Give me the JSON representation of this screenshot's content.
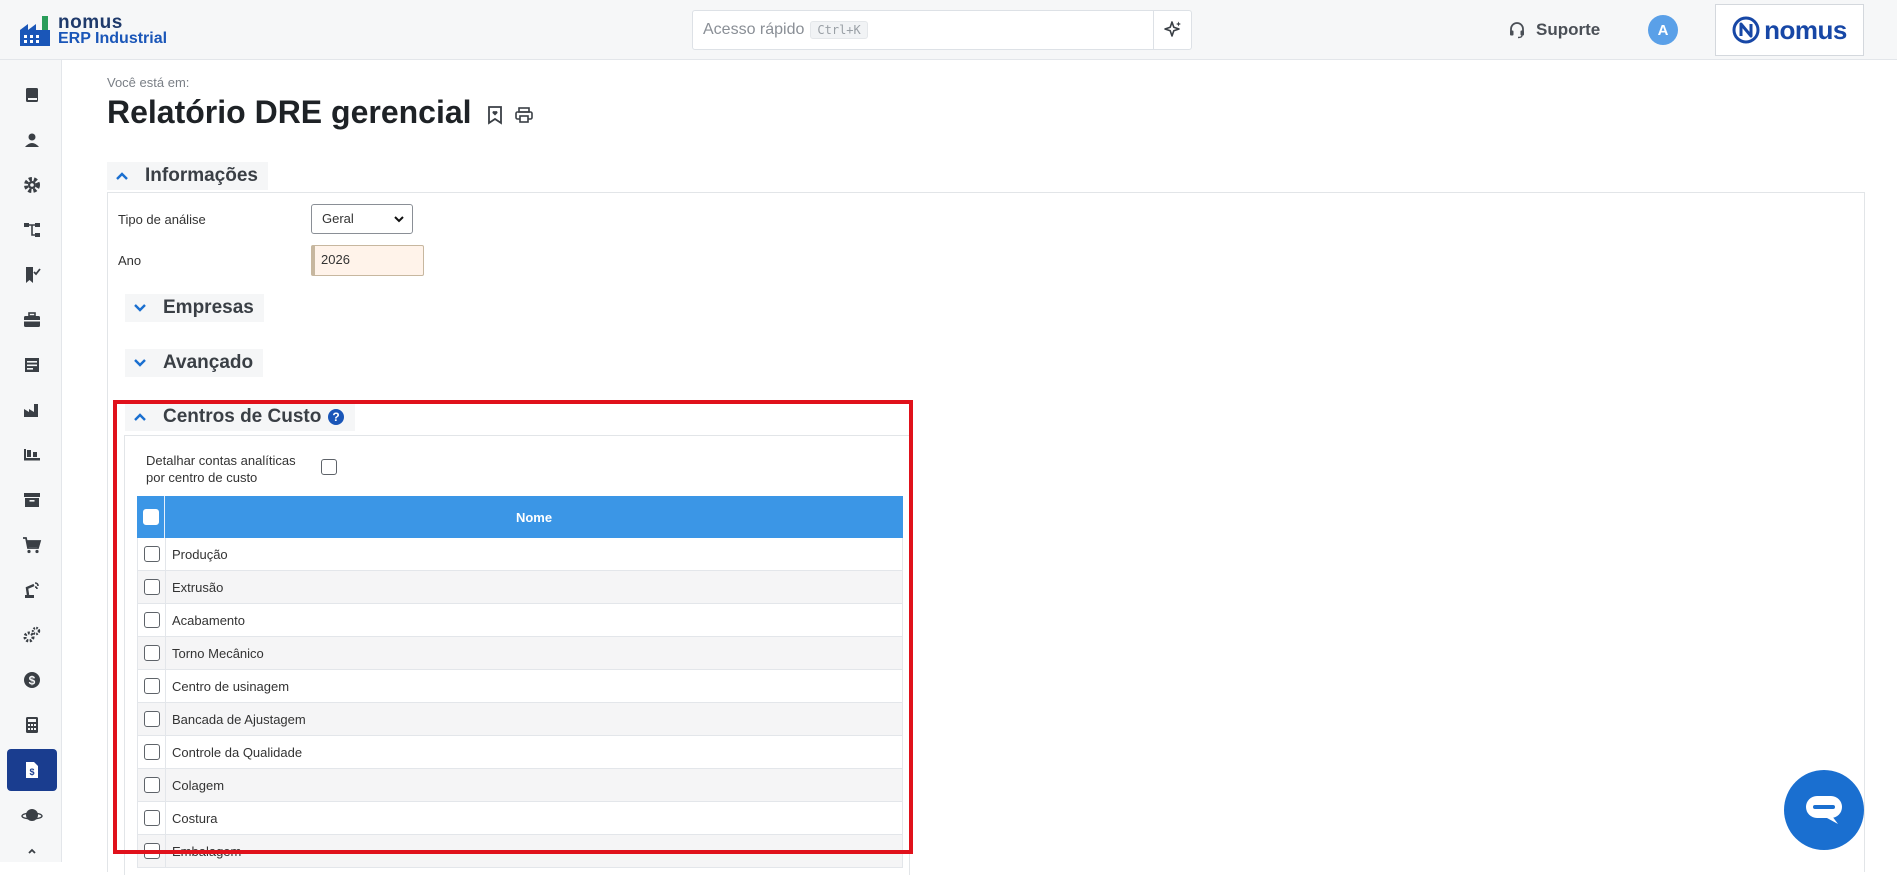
{
  "topbar": {
    "logo_line1": "nomus",
    "logo_line2": "ERP Industrial",
    "quick_access_placeholder": "Acesso rápido",
    "quick_access_shortcut": "Ctrl+K",
    "support_label": "Suporte",
    "avatar_initial": "A",
    "brand_text": "nomus"
  },
  "sidebar": {
    "items": [
      {
        "icon": "book-icon"
      },
      {
        "icon": "user-icon"
      },
      {
        "icon": "gear-icon"
      },
      {
        "icon": "hierarchy-icon"
      },
      {
        "icon": "bookmark-check-icon"
      },
      {
        "icon": "briefcase-icon"
      },
      {
        "icon": "document-list-icon"
      },
      {
        "icon": "factory-icon"
      },
      {
        "icon": "conveyor-icon"
      },
      {
        "icon": "archive-icon"
      },
      {
        "icon": "cart-icon"
      },
      {
        "icon": "robot-arm-icon"
      },
      {
        "icon": "gears-icon"
      },
      {
        "icon": "dollar-icon"
      },
      {
        "icon": "calculator-icon"
      },
      {
        "icon": "financial-report-icon",
        "active": true
      },
      {
        "icon": "planet-icon"
      }
    ]
  },
  "page": {
    "breadcrumb": "Você está em:",
    "title": "Relatório DRE gerencial"
  },
  "informacoes": {
    "heading": "Informações",
    "tipo_label": "Tipo de análise",
    "tipo_value": "Geral",
    "ano_label": "Ano",
    "ano_value": "2026"
  },
  "empresas": {
    "heading": "Empresas"
  },
  "avancado": {
    "heading": "Avançado"
  },
  "centros": {
    "heading": "Centros de Custo",
    "detail_label": "Detalhar contas analíticas por centro de custo",
    "column_header": "Nome",
    "rows": [
      "Produção",
      "Extrusão",
      "Acabamento",
      "Torno Mecânico",
      "Centro de usinagem",
      "Bancada de Ajustagem",
      "Controle da Qualidade",
      "Colagem",
      "Costura",
      "Embalagem"
    ]
  },
  "colors": {
    "accent": "#3b96e6",
    "highlight": "#e0111b",
    "sidebar_active": "#1a3d8f",
    "chat_button": "#1a6fd0"
  }
}
